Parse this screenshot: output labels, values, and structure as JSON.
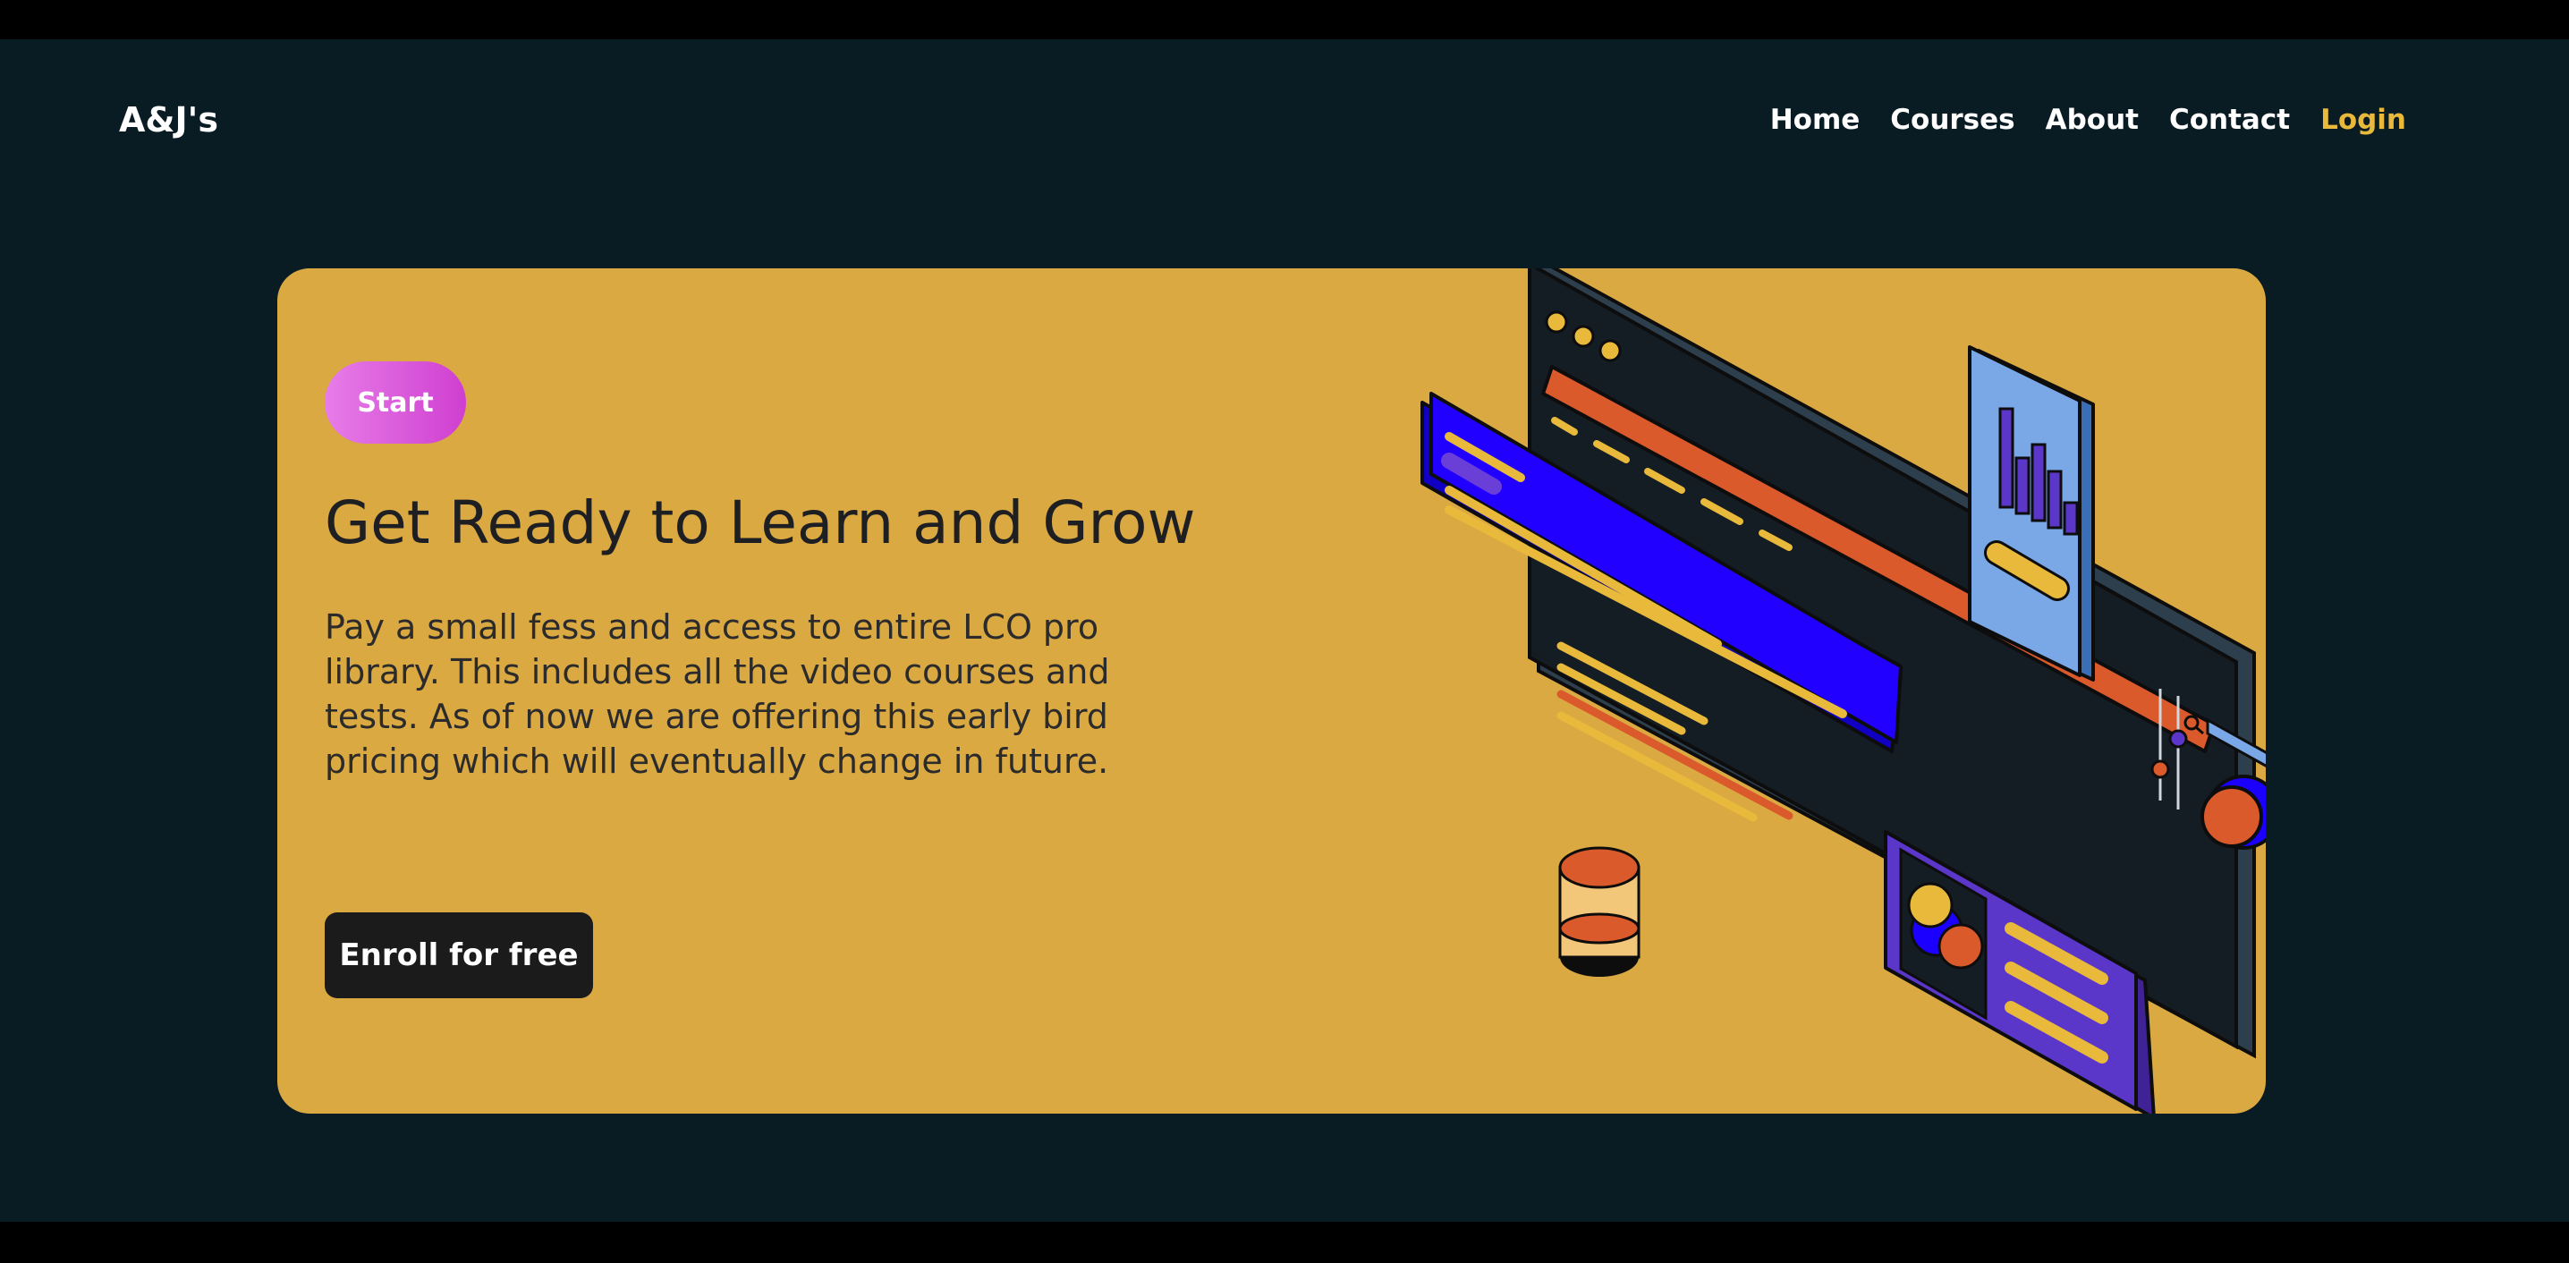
{
  "nav": {
    "logo": "A&J's",
    "links": [
      "Home",
      "Courses",
      "About",
      "Contact"
    ],
    "login": "Login"
  },
  "hero": {
    "badge": "Start",
    "title": "Get Ready to Learn and Grow",
    "description": "Pay a small fess and access to entire LCO pro library. This includes all the video courses and tests. As of now we are offering this early bird pricing which will eventually change in future.",
    "cta": "Enroll for free"
  },
  "colors": {
    "page_bg": "#091b23",
    "card_bg": "#dba942",
    "login_accent": "#e8b93a",
    "pill_gradient_start": "#e77de8",
    "pill_gradient_end": "#cf3fd0",
    "button_bg": "#1b1b1b"
  },
  "icons": {
    "illustration": "isometric-dashboard-illustration",
    "chart": "bar-chart-icon",
    "search": "search-icon",
    "database": "database-icon"
  }
}
